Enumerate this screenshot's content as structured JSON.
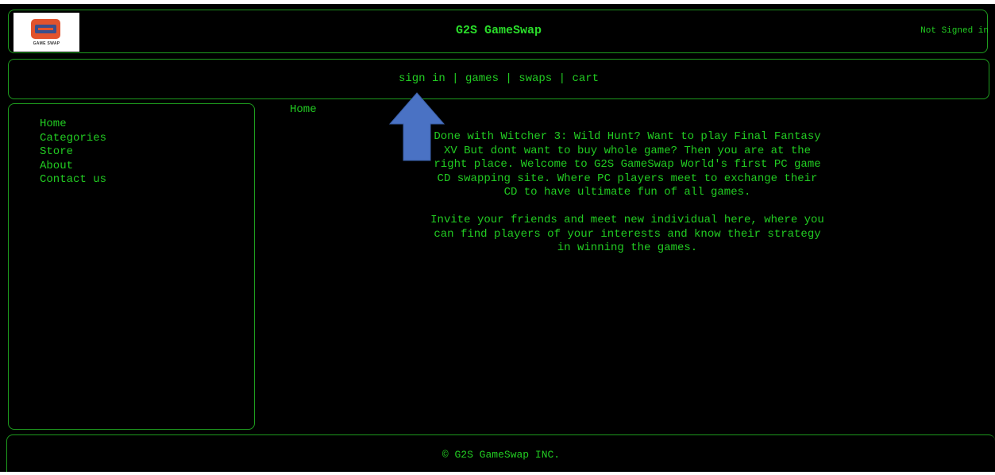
{
  "header": {
    "logo_text": "GAME SWAP",
    "title": "G2S GameSwap",
    "user_status": "Not Signed in"
  },
  "nav": {
    "items": [
      {
        "label": "sign in"
      },
      {
        "label": "games"
      },
      {
        "label": "swaps"
      },
      {
        "label": "cart"
      }
    ],
    "separator": "|"
  },
  "sidebar": {
    "items": [
      {
        "label": "Home"
      },
      {
        "label": "Categories"
      },
      {
        "label": "Store"
      },
      {
        "label": "About"
      },
      {
        "label": "Contact us"
      }
    ]
  },
  "main": {
    "breadcrumb": "Home",
    "paragraphs": [
      "Done with Witcher 3: Wild Hunt? Want to play Final Fantasy XV But dont want to buy whole game? Then you are at the right place. Welcome to G2S GameSwap World's first PC game CD swapping site. Where PC players meet to exchange their CD to have ultimate fun of all games.",
      "Invite your friends and meet new individual here, where you can find players of your interests and know their strategy in winning the games."
    ]
  },
  "footer": {
    "text": "© G2S GameSwap INC."
  },
  "colors": {
    "background": "#000000",
    "text": "#22cc22",
    "border": "#1e9c1e",
    "arrow": "#4a72c4"
  }
}
